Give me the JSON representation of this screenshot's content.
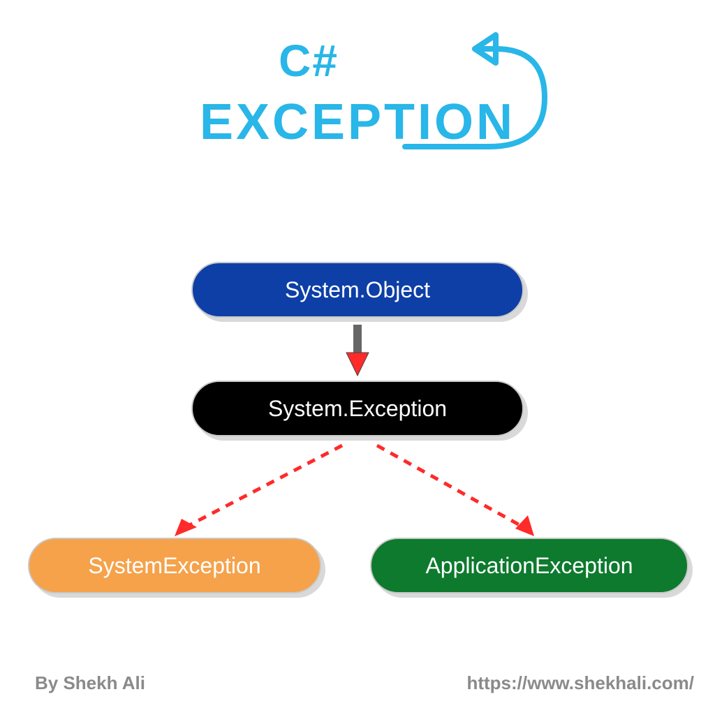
{
  "title": {
    "line1": "C#",
    "line2": "EXCEPTION"
  },
  "nodes": {
    "object": "System.Object",
    "exception": "System.Exception",
    "system_exception": "SystemException",
    "application_exception": "ApplicationException"
  },
  "footer": {
    "author": "By Shekh Ali",
    "url": "https://www.shekhali.com/"
  },
  "colors": {
    "title": "#29b6e8",
    "node_object": "#0d3fa6",
    "node_exception": "#000000",
    "node_system": "#f5a24b",
    "node_application": "#0d7a2e",
    "arrow_red": "#ff2a2a",
    "footer_gray": "#8a8a8a"
  },
  "chart_data": {
    "type": "diagram",
    "title": "C# Exception Hierarchy",
    "nodes": [
      {
        "id": "object",
        "label": "System.Object"
      },
      {
        "id": "exception",
        "label": "System.Exception"
      },
      {
        "id": "system_exception",
        "label": "SystemException"
      },
      {
        "id": "application_exception",
        "label": "ApplicationException"
      }
    ],
    "edges": [
      {
        "from": "object",
        "to": "exception",
        "style": "solid"
      },
      {
        "from": "exception",
        "to": "system_exception",
        "style": "dashed"
      },
      {
        "from": "exception",
        "to": "application_exception",
        "style": "dashed"
      }
    ]
  }
}
